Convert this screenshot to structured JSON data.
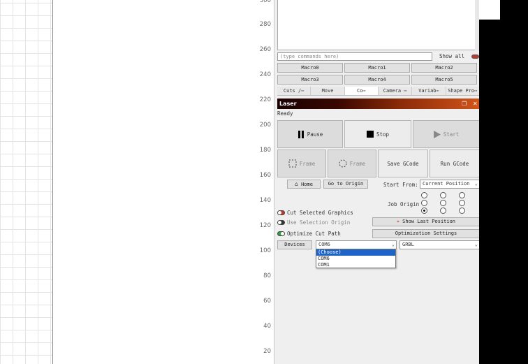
{
  "ruler": {
    "ticks": [
      "280",
      "260",
      "240",
      "220",
      "200",
      "180",
      "160",
      "140",
      "120",
      "100",
      "80",
      "60",
      "40",
      "20"
    ]
  },
  "console": {
    "input_placeholder": "(type commands here)",
    "show_all_label": "Show all"
  },
  "macros": [
    "Macro0",
    "Macro1",
    "Macro2",
    "Macro3",
    "Macro4",
    "Macro5"
  ],
  "tabs": [
    "Cuts /⋯",
    "Move",
    "Co⋯",
    "Camera ⋯",
    "Variab⋯",
    "Shape Pro⋯"
  ],
  "laser": {
    "title": "Laser",
    "status": "Ready",
    "pause_label": "Pause",
    "stop_label": "Stop",
    "start_label": "Start",
    "frame1_label": "Frame",
    "frame2_label": "Frame",
    "save_gcode_label": "Save GCode",
    "run_gcode_label": "Run GCode",
    "home_label": "Home",
    "go_origin_label": "Go to Origin",
    "start_from_label": "Start From:",
    "start_from_value": "Current Position",
    "job_origin_label": "Job Origin",
    "cut_selected_label": "Cut Selected Graphics",
    "use_selection_origin_label": "Use Selection Origin",
    "optimize_cut_path_label": "Optimize Cut Path",
    "show_last_position_label": "Show Last Position",
    "optimization_settings_label": "Optimization Settings",
    "devices_label": "Devices",
    "port_value": "COM6",
    "device_type_value": "GRBL",
    "port_options": [
      "(Choose)",
      "COM6",
      "COM1"
    ]
  },
  "colors": {
    "accent_selection": "#1e64c8",
    "title_gradient_end": "#d2541a",
    "toggle_on": "#2ea043",
    "toggle_red": "#c0392b"
  }
}
